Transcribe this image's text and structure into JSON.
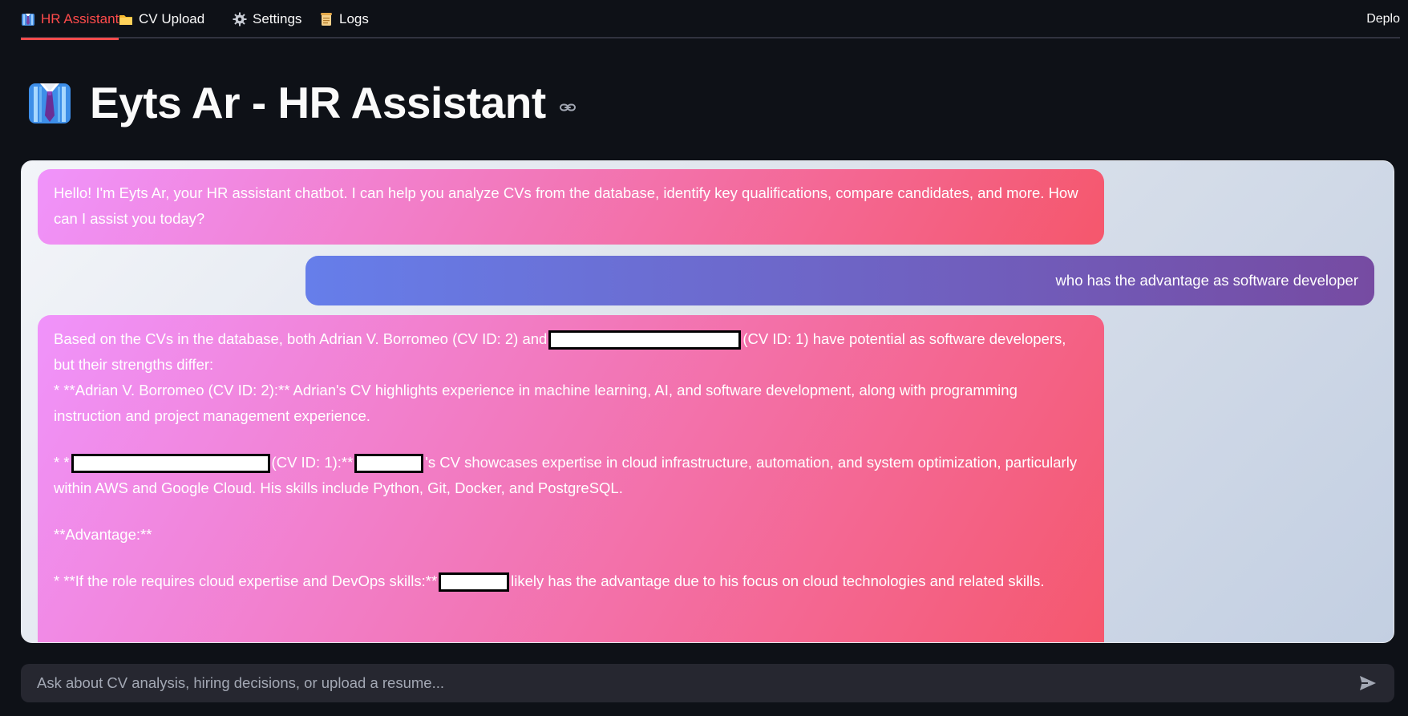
{
  "tabs": [
    {
      "label": "HR Assistant",
      "icon": "necktie-icon",
      "active": true
    },
    {
      "label": "CV Upload",
      "icon": "folder-icon",
      "active": false
    },
    {
      "label": "Settings",
      "icon": "gear-icon",
      "active": false
    },
    {
      "label": "Logs",
      "icon": "scroll-icon",
      "active": false
    }
  ],
  "header": {
    "deploy_label": "Deplo"
  },
  "page": {
    "title": "Eyts Ar - HR Assistant",
    "title_icon": "necktie-icon"
  },
  "chat": {
    "messages": [
      {
        "role": "assistant",
        "text": "Hello! I'm Eyts Ar, your HR assistant chatbot. I can help you analyze CVs from the database, identify key qualifications, compare candidates, and more. How can I assist you today?"
      },
      {
        "role": "user",
        "text": "who has the advantage as software developer"
      },
      {
        "role": "assistant",
        "p1a": "Based on the CVs in the database, both Adrian V. Borromeo (CV ID: 2) and",
        "p1b": "(CV ID: 1) have potential as software developers, but their strengths differ:",
        "p2": "* **Adrian V. Borromeo (CV ID: 2):** Adrian's CV highlights experience in machine learning, AI, and software development, along with programming instruction and project management experience.",
        "p3a": "* *",
        "p3b": "(CV ID: 1):**",
        "p3c": "'s CV showcases expertise in cloud infrastructure, automation, and system optimization, particularly within AWS and Google Cloud. His skills include Python, Git, Docker, and PostgreSQL.",
        "p4": "**Advantage:**",
        "p5a": "* **If the role requires cloud expertise and DevOps skills:**",
        "p5b": "likely has the advantage due to his focus on cloud technologies and related skills."
      }
    ]
  },
  "input": {
    "placeholder": "Ask about CV analysis, hiring decisions, or upload a resume..."
  },
  "colors": {
    "accent": "#ff4b4b",
    "background": "#0e1117",
    "bot_gradient_start": "#f093fb",
    "bot_gradient_end": "#f5576c",
    "user_gradient_start": "#667eea",
    "user_gradient_end": "#764ba2"
  }
}
